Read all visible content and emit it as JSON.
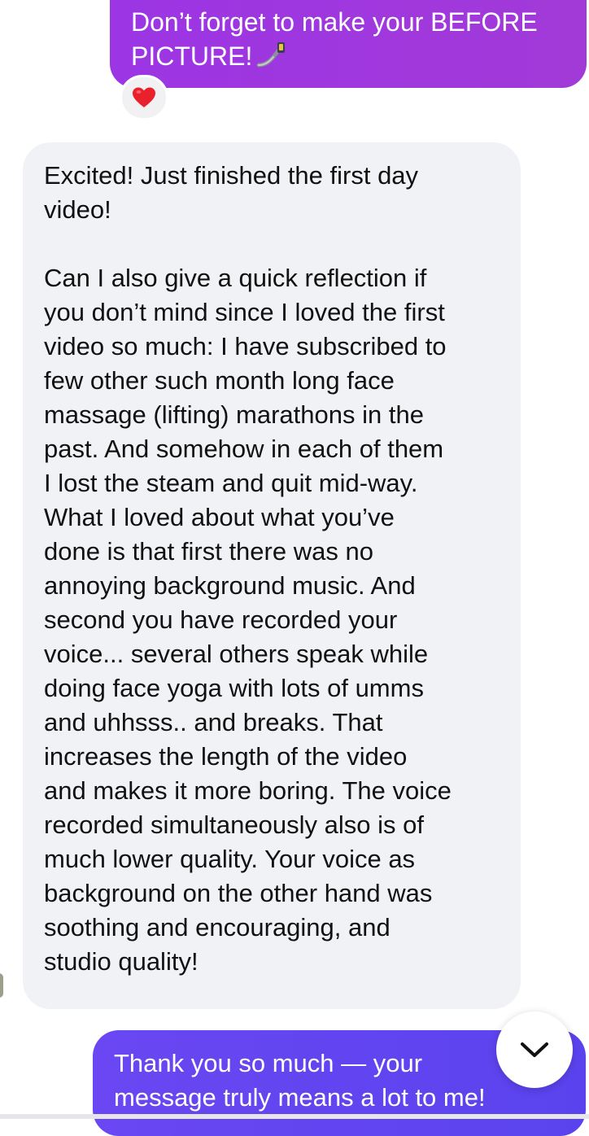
{
  "messages": {
    "outgoing_top": {
      "text": "Don’t forget to make your BEFORE PICTURE!",
      "emoji": "selfie-stick-emoji",
      "color": "#9c35e4"
    },
    "reaction": {
      "emoji": "❤️",
      "icon": "heart-icon"
    },
    "incoming": {
      "paragraph_1": "Excited! Just finished the first day\nvideo!",
      "paragraph_2": "Can I also give a quick reflection if\nyou don’t mind since I loved the first\nvideo so much: I have subscribed to\nfew other such month long face\nmassage (lifting) marathons in the\npast. And somehow in each of them\nI lost the steam and quit mid-way.\nWhat I loved about what you’ve\ndone is that first there was no\nannoying background music. And\nsecond you have recorded your\nvoice... several others speak while\ndoing face yoga with lots of umms\nand uhhsss.. and breaks. That\nincreases the length of the video\nand makes it more boring. The voice\nrecorded simultaneously also is of\nmuch lower quality. Your voice as\nbackground on the other hand was\nsoothing and encouraging, and\nstudio quality!",
      "color": "#f1f2f5"
    },
    "outgoing_bottom": {
      "text": "Thank you so much — your\nmessage truly means a lot to me!",
      "color": "#6a47f2"
    }
  },
  "controls": {
    "scroll_down_icon": "chevron-down-icon"
  }
}
